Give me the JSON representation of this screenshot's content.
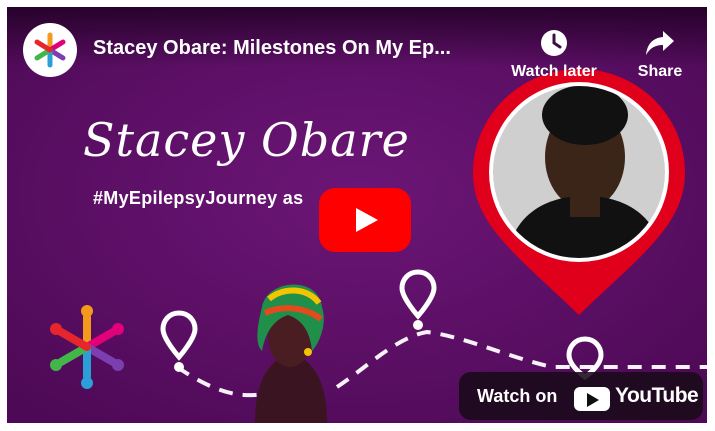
{
  "video": {
    "title": "Stacey Obare: Milestones On My Ep...",
    "channel_logo_icon": "colorful-people-circle-logo-icon"
  },
  "actions": {
    "watch_later_label": "Watch later",
    "watch_later_icon": "clock-icon",
    "share_label": "Share",
    "share_icon": "share-arrow-icon"
  },
  "thumbnail": {
    "script_name": "Stacey Obare",
    "hashtag": "#MyEpilepsyJourney as",
    "background_color": "#5a0c63",
    "pin_color": "#e0001b"
  },
  "play_button": {
    "icon": "youtube-play-icon",
    "color": "#ff0000"
  },
  "watch_on": {
    "label": "Watch on",
    "brand": "YouTube",
    "icon": "youtube-logo-icon"
  }
}
